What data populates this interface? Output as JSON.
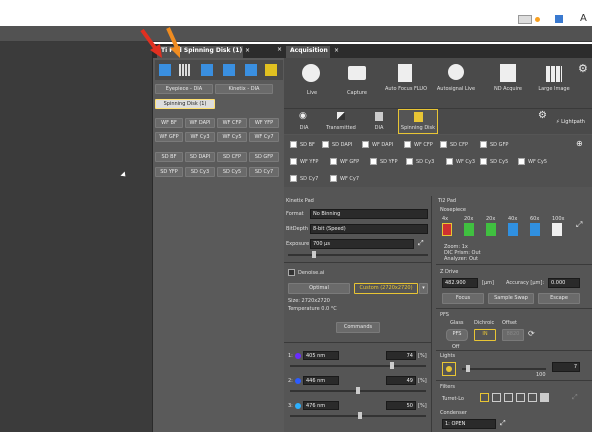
{
  "mid_tab": "Ti Pad  Spinning Disk (1)",
  "mid_tab_close": "×",
  "mid_buttons": [
    {
      "label": "Eyepiece - DIA"
    },
    {
      "label": "Kinetix - DIA"
    }
  ],
  "mid_selected": "Spinning Disk (1)",
  "mid_rows1": [
    "WF BF",
    "WF DAPI",
    "WF CFP",
    "WF YFP",
    "WF GFP",
    "WF Cy3",
    "WF Cy5",
    "WF Cy7"
  ],
  "mid_rows2": [
    "SD BF",
    "SD DAPI",
    "SD CFP",
    "SD GFP",
    "SD YFP",
    "SD Cy3",
    "SD Cy5",
    "SD Cy7"
  ],
  "acq_tab": "Acquisition",
  "acq_close": "×",
  "acq_buttons": [
    "Live",
    "Capture",
    "Auto Focus FLUO",
    "Autosignal Live",
    "ND Acquire",
    "Large Image"
  ],
  "mode_buttons": [
    "DIA",
    "Transmitted",
    "DIA",
    "Spinning Disk"
  ],
  "lightpath": "Lightpath",
  "channels": [
    "SD BF",
    "SD DAPI",
    "WF DAPI",
    "WF CFP",
    "SD CFP",
    "SD GFP",
    "WF YFP",
    "WF GFP",
    "SD YFP",
    "SD Cy3",
    "WF Cy3",
    "SD Cy5",
    "WF Cy5",
    "SD Cy7",
    "WF Cy7"
  ],
  "kinetix": {
    "title": "Kinetix Pad",
    "format_label": "Format",
    "format": "No Binning",
    "bitdepth_label": "BitDepth",
    "bitdepth": "8-bit (Speed)",
    "exposure_label": "Exposure",
    "exposure": "700 µs",
    "denoise": "Denoise.ai",
    "optimal": "Optimal",
    "custom": "Custom (2720x2720)",
    "size": "Size: 2720x2720",
    "temp": "Temperature 0.0 °C",
    "commands": "Commands"
  },
  "lasers": [
    {
      "name": "405 nm",
      "value": "74",
      "unit": "[%]",
      "color": "#6a2cff"
    },
    {
      "name": "446 nm",
      "value": "49",
      "unit": "[%]",
      "color": "#2c5cff"
    },
    {
      "name": "476 nm",
      "value": "50",
      "unit": "[%]",
      "color": "#2cb0ff"
    }
  ],
  "tipad": {
    "title": "Ti2 Pad",
    "nosepiece": "Nosepiece",
    "objectives": [
      {
        "mag": "4x",
        "pos": "1",
        "color": "#d03030"
      },
      {
        "mag": "20x",
        "pos": "2",
        "color": "#40c040"
      },
      {
        "mag": "20x",
        "pos": "3",
        "color": "#40c040"
      },
      {
        "mag": "40x",
        "pos": "4",
        "color": "#e0c020"
      },
      {
        "mag": "60x",
        "pos": "5",
        "color": "#3090e0"
      },
      {
        "mag": "100x",
        "pos": "6",
        "color": "#f0f0f0"
      }
    ],
    "zoom": "Zoom: 1x",
    "dic": "DIC Prism: Out",
    "analyzer": "Analyzer: Out",
    "zdrive": "Z Drive",
    "zvalue": "482.900",
    "zunit": "[µm]",
    "accuracy": "Accuracy [µm]:",
    "accvalue": "0.000",
    "focus": "Focus",
    "sampleswap": "Sample Swap",
    "escape": "Escape",
    "pfs": "PFS",
    "glass": "Glass",
    "dichroic": "Dichroic",
    "offset": "Offset",
    "pfsbtn": "PFS",
    "inbtn": "IN",
    "offsetval": "8820",
    "off": "Off",
    "lights": "Lights",
    "lightmax": "100",
    "lightval": "7",
    "filters": "Filters",
    "turret": "Turret-Lo",
    "condenser": "Condenser",
    "condval": "1: OPEN"
  }
}
